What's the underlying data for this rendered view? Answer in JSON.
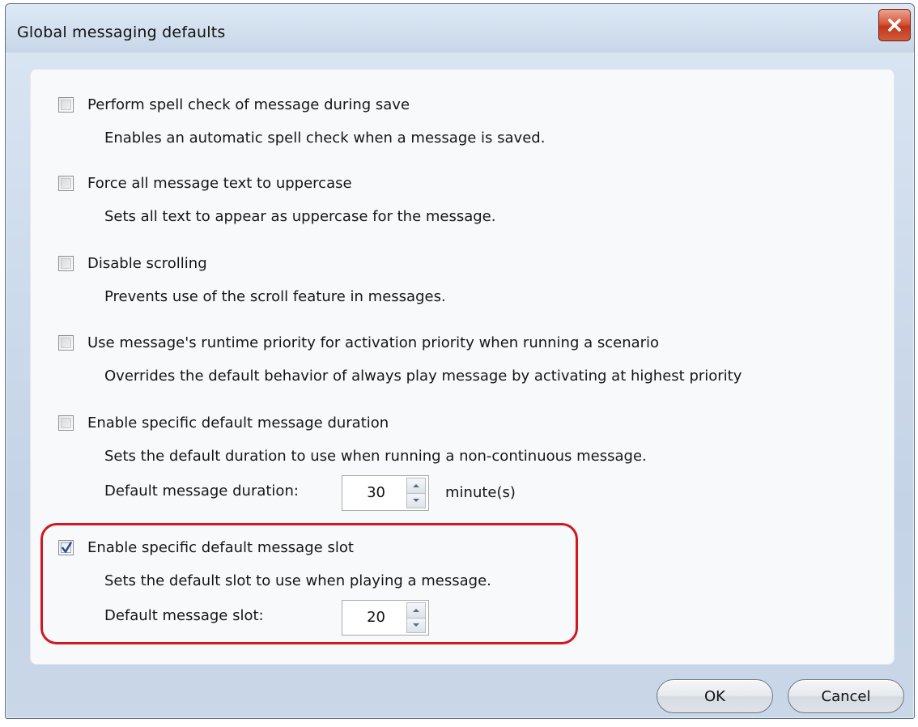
{
  "window": {
    "title": "Global messaging defaults",
    "close_icon": "close-icon",
    "close_color": "#c8401f"
  },
  "options": [
    {
      "label": "Perform spell check of message during save",
      "description": "Enables an automatic spell check when a message is saved.",
      "checked": false
    },
    {
      "label": "Force all message text to uppercase",
      "description": "Sets all text to appear as uppercase for the message.",
      "checked": false
    },
    {
      "label": "Disable scrolling",
      "description": "Prevents use of the scroll feature in messages.",
      "checked": false
    },
    {
      "label": "Use message's runtime priority for activation priority when running a scenario",
      "description": "Overrides the default behavior of always play message by activating at highest priority",
      "checked": false
    },
    {
      "label": "Enable specific default message duration",
      "description": "Sets the default duration to use when running a non-continuous message.",
      "checked": false,
      "field_label": "Default message duration:",
      "field_value": "30",
      "field_unit": "minute(s)"
    },
    {
      "label": "Enable specific default message slot",
      "description": "Sets the default slot to use when playing a message.",
      "checked": true,
      "field_label": "Default message slot:",
      "field_value": "20"
    }
  ],
  "highlight_color": "#d2171e",
  "buttons": {
    "ok_label": "OK",
    "cancel_label": "Cancel"
  }
}
